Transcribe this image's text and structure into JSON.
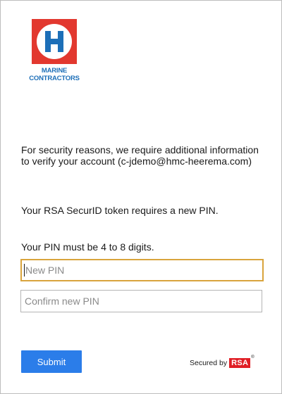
{
  "logo": {
    "line1": "MARINE",
    "line2": "CONTRACTORS",
    "brand_red": "#e2382f",
    "brand_blue": "#1d6fb8"
  },
  "messages": {
    "security": "For security reasons, we require additional information to verify your account (c-jdemo@hmc-heerema.com)",
    "token": "Your RSA SecurID token requires a new PIN.",
    "pin_length": "Your PIN must be 4 to 8 digits."
  },
  "form": {
    "new_pin_placeholder": "New PIN",
    "new_pin_value": "",
    "confirm_pin_placeholder": "Confirm new PIN",
    "confirm_pin_value": "",
    "submit_label": "Submit",
    "focus_color": "#d9a43c",
    "submit_color": "#2b7de9"
  },
  "footer": {
    "secured_label": "Secured by",
    "rsa_text": "RSA",
    "reg_mark": "®",
    "rsa_color": "#e01e25"
  }
}
